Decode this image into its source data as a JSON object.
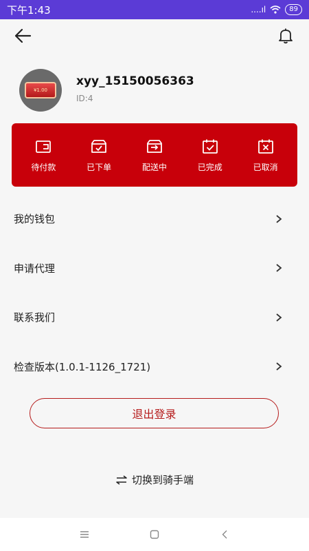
{
  "status_bar": {
    "time": "下午1:43",
    "signal": "....ıl",
    "battery": "89"
  },
  "profile": {
    "username": "xyy_15150056363",
    "id_text": "ID:4",
    "avatar_text": "¥1.00"
  },
  "orders": [
    {
      "label": "待付款",
      "icon": "wallet-icon"
    },
    {
      "label": "已下单",
      "icon": "ordered-icon"
    },
    {
      "label": "配送中",
      "icon": "delivery-icon"
    },
    {
      "label": "已完成",
      "icon": "completed-icon"
    },
    {
      "label": "已取消",
      "icon": "cancelled-icon"
    }
  ],
  "menu": [
    {
      "label": "我的钱包"
    },
    {
      "label": "申请代理"
    },
    {
      "label": "联系我们"
    },
    {
      "label": "检查版本(1.0.1-1126_1721)"
    }
  ],
  "logout_label": "退出登录",
  "switch_label": "切换到骑手端",
  "colors": {
    "status_bar": "#5b3bd6",
    "brand_red": "#c8000a",
    "background": "#f6f6f6"
  }
}
